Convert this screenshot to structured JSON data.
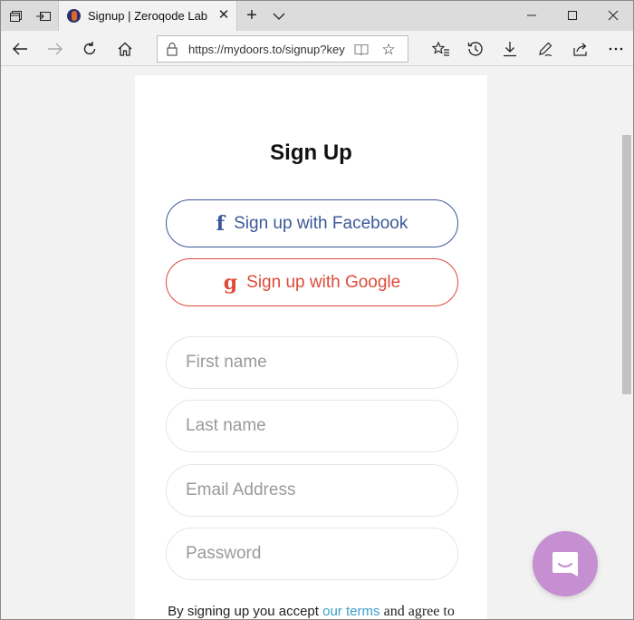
{
  "browser": {
    "tab_title": "Signup | Zeroqode Lab",
    "tab_close": "✕",
    "new_tab": "+",
    "address": "https://mydoors.to/signup?key"
  },
  "page": {
    "title": "Sign Up",
    "facebook_glyph": "f",
    "facebook_label": "Sign up with Facebook",
    "google_glyph": "g",
    "google_label": "Sign up with Google",
    "first_name_placeholder": "First name",
    "last_name_placeholder": "Last name",
    "email_placeholder": "Email Address",
    "password_placeholder": "Password",
    "terms_prefix": "By signing up you accept",
    "terms_link": "our terms",
    "terms_suffix": "and agree to"
  },
  "colors": {
    "facebook": "#3b5998",
    "google": "#dd4b39",
    "link": "#3aa0c8",
    "chat_bubble": "#c58fd1"
  }
}
